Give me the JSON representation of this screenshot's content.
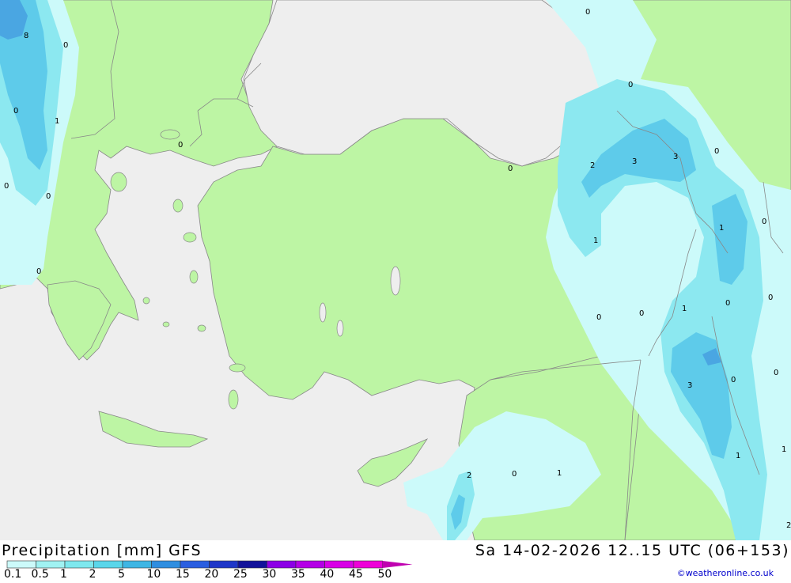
{
  "header": {
    "title": "Precipitation [mm] GFS",
    "datetime": "Sa 14-02-2026 12..15 UTC (06+153)",
    "credit": "©weatheronline.co.uk"
  },
  "legend": {
    "labels": [
      "0.1",
      "0.5",
      "1",
      "2",
      "5",
      "10",
      "15",
      "20",
      "25",
      "30",
      "35",
      "40",
      "45",
      "50"
    ],
    "colors": [
      "#ccfafa",
      "#a0f2f2",
      "#7ee8ee",
      "#5ad6ea",
      "#3fb6e4",
      "#2f8ee0",
      "#2a5ee0",
      "#1f37c8",
      "#12129a",
      "#8c00e6",
      "#b400e6",
      "#d800e6",
      "#ee00d8",
      "#c000b0"
    ]
  },
  "map": {
    "colors": {
      "sea": "#eeeeee",
      "land": "#bdf5a4",
      "border": "#888888",
      "rain_light": "#ccfafa",
      "rain_mid": "#8ce8f0",
      "rain_heavy": "#5ecbea",
      "rain_max": "#4aa6e2"
    },
    "labels": [
      "8",
      "0",
      "0",
      "1",
      "0",
      "0",
      "0",
      "0",
      "0",
      "0",
      "2",
      "3",
      "3",
      "0",
      "1",
      "1",
      "0",
      "1",
      "0",
      "0",
      "0",
      "0",
      "3",
      "0",
      "1",
      "0",
      "2",
      "0",
      "1",
      "1",
      "2"
    ]
  }
}
